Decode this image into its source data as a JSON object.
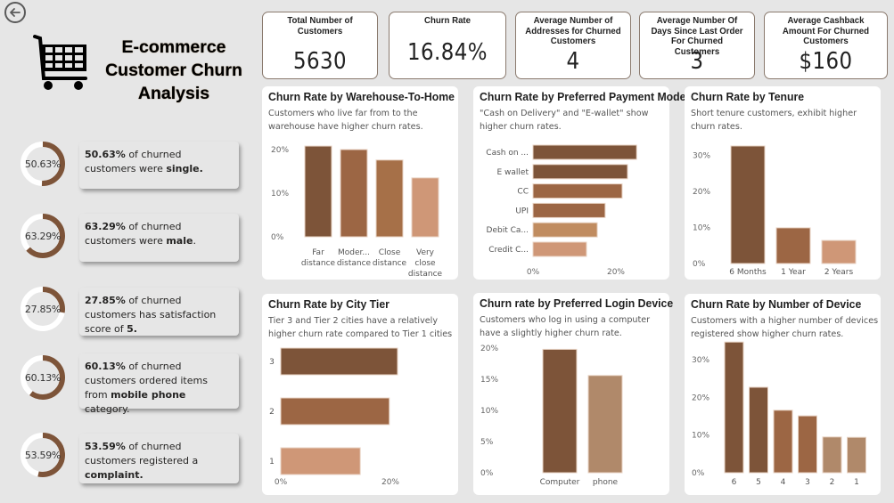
{
  "header": {
    "back_icon": "back-arrow-circle-icon",
    "logo_icon": "shopping-cart-icon",
    "title_lines": [
      "E-commerce",
      "Customer Churn",
      "Analysis"
    ]
  },
  "colors": {
    "dark_brown": "#7d5439",
    "mid_brown": "#9c6644",
    "light_brown": "#a67048",
    "tan": "#b0896a",
    "peach": "#cf9777",
    "sand": "#c08c60",
    "background": "#e6e6e6",
    "panel": "#ffffff"
  },
  "kpis": [
    {
      "label": "Total Number of Customers",
      "value": "5630"
    },
    {
      "label": "Churn Rate",
      "value": "16.84%"
    },
    {
      "label": "Average Number of Addresses for Churned Customers",
      "value": "4"
    },
    {
      "label": "Average Number Of Days Since Last Order For Churned Customers",
      "value": "3"
    },
    {
      "label": "Average Cashback Amount For Churned Customers",
      "value": "$160"
    }
  ],
  "facts": [
    {
      "percent": 50.63,
      "percent_label": "50.63%",
      "bold_lead": "50.63%",
      "text_mid": " of churned customers were ",
      "bold_tail": "single.",
      "text_end": ""
    },
    {
      "percent": 63.29,
      "percent_label": "63.29%",
      "bold_lead": "63.29%",
      "text_mid": " of churned customers were ",
      "bold_tail": "male",
      "text_end": "."
    },
    {
      "percent": 27.85,
      "percent_label": "27.85%",
      "bold_lead": "27.85%",
      "text_mid": " of churned customers has satisfaction score of ",
      "bold_tail": "5.",
      "text_end": ""
    },
    {
      "percent": 60.13,
      "percent_label": "60.13%",
      "bold_lead": "60.13%",
      "text_mid": " of churned customers ordered items from ",
      "bold_tail": "mobile phone",
      "text_end": " category."
    },
    {
      "percent": 53.59,
      "percent_label": "53.59%",
      "bold_lead": "53.59%",
      "text_mid": " of churned customers registered a ",
      "bold_tail": "complaint.",
      "text_end": ""
    }
  ],
  "chart_data": [
    {
      "id": "warehouse",
      "type": "bar",
      "orientation": "vertical",
      "title": "Churn Rate by Warehouse-To-Home",
      "subtitle": "Customers who live far from to the warehouse have higher churn rates.",
      "categories": [
        [
          "Far",
          "distance"
        ],
        [
          "Moder...",
          "distance"
        ],
        [
          "Close",
          "distance"
        ],
        [
          "Very",
          "close",
          "distance"
        ]
      ],
      "values": [
        20.8,
        20.0,
        17.6,
        13.5
      ],
      "colors": [
        "#7d5439",
        "#9c6644",
        "#a67048",
        "#cf9777"
      ],
      "yticks": [
        0,
        10,
        20
      ],
      "ytick_labels": [
        "0%",
        "10%",
        "20%"
      ],
      "ylim": [
        0,
        20
      ],
      "grid": false
    },
    {
      "id": "payment",
      "type": "bar",
      "orientation": "horizontal",
      "title": "Churn Rate by Preferred Payment Mode",
      "subtitle": "\"Cash on Delivery\" and \"E-wallet\" show higher churn rates.",
      "categories": [
        "Cash on ...",
        "E wallet",
        "CC",
        "UPI",
        "Debit Ca...",
        "Credit C..."
      ],
      "values": [
        25.0,
        22.8,
        21.5,
        17.4,
        15.5,
        12.9
      ],
      "colors": [
        "#7d5439",
        "#7d5439",
        "#9c6644",
        "#9c6644",
        "#c08c60",
        "#cf9777"
      ],
      "xticks": [
        0,
        20
      ],
      "xtick_labels": [
        "0%",
        "20%"
      ],
      "xlim": [
        0,
        20
      ],
      "grid": false
    },
    {
      "id": "tenure",
      "type": "bar",
      "orientation": "vertical",
      "title": "Churn Rate by Tenure",
      "subtitle": "Short tenure customers, exhibit higher churn rates.",
      "categories": [
        [
          "6 Months"
        ],
        [
          "1 Year"
        ],
        [
          "2 Years"
        ]
      ],
      "values": [
        32.6,
        9.9,
        6.4
      ],
      "colors": [
        "#7d5439",
        "#9c6644",
        "#cf9777"
      ],
      "yticks": [
        0,
        10,
        20,
        30
      ],
      "ytick_labels": [
        "0%",
        "10%",
        "20%",
        "30%"
      ],
      "ylim": [
        0,
        30
      ],
      "grid": false
    },
    {
      "id": "citytier",
      "type": "bar",
      "orientation": "horizontal",
      "title": "Churn Rate by City Tier",
      "subtitle": "Tier 3 and Tier 2 cities have a relatively higher churn rate compared to Tier 1 cities",
      "categories": [
        "3",
        "2",
        "1"
      ],
      "values": [
        21.3,
        19.8,
        14.5
      ],
      "colors": [
        "#7d5439",
        "#9c6644",
        "#cf9777"
      ],
      "xticks": [
        0,
        20
      ],
      "xtick_labels": [
        "0%",
        "20%"
      ],
      "xlim": [
        0,
        20
      ],
      "grid": false
    },
    {
      "id": "login",
      "type": "bar",
      "orientation": "vertical",
      "title": "Churn rate by Preferred Login Device",
      "subtitle": "Customers who log in using a computer have a slightly higher churn rate.",
      "categories": [
        [
          "Computer"
        ],
        [
          "phone"
        ]
      ],
      "values": [
        19.8,
        15.6
      ],
      "colors": [
        "#7d5439",
        "#b0896a"
      ],
      "yticks": [
        0,
        5,
        10,
        15,
        20
      ],
      "ytick_labels": [
        "0%",
        "5%",
        "10%",
        "15%",
        "20%"
      ],
      "ylim": [
        0,
        20
      ],
      "grid": false
    },
    {
      "id": "devices",
      "type": "bar",
      "orientation": "vertical",
      "title": "Churn Rate by Number of Device",
      "subtitle": "Customers with a higher number of devices registered show higher churn rates.",
      "categories": [
        [
          "6"
        ],
        [
          "5"
        ],
        [
          "4"
        ],
        [
          "3"
        ],
        [
          "2"
        ],
        [
          "1"
        ]
      ],
      "values": [
        34.7,
        22.7,
        16.6,
        15.1,
        9.5,
        9.4
      ],
      "colors": [
        "#7d5439",
        "#7d5439",
        "#9c6644",
        "#9c6644",
        "#b0896a",
        "#b0896a"
      ],
      "yticks": [
        0,
        10,
        20,
        30
      ],
      "ytick_labels": [
        "0%",
        "10%",
        "20%",
        "30%"
      ],
      "ylim": [
        0,
        30
      ],
      "grid": false
    }
  ]
}
